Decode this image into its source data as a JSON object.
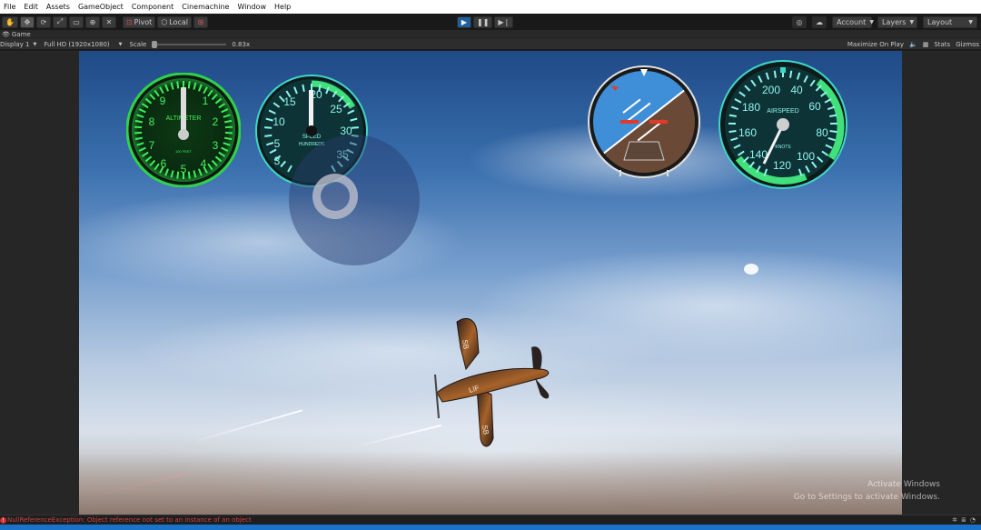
{
  "menu": [
    "File",
    "Edit",
    "Assets",
    "GameObject",
    "Component",
    "Cinemachine",
    "Window",
    "Help"
  ],
  "toolbar": {
    "pivot_label": "Pivot",
    "local_label": "Local",
    "account_label": "Account",
    "layers_label": "Layers",
    "layout_label": "Layout"
  },
  "tab": {
    "title": "Game"
  },
  "gamebar": {
    "display": "Display 1",
    "resolution": "Full HD (1920x1080)",
    "scale_label": "Scale",
    "scale_value": "0.83x",
    "scale_fraction": 0.0,
    "maximize": "Maximize On Play",
    "stats": "Stats",
    "gizmos": "Gizmos"
  },
  "gauges": {
    "altimeter": {
      "label": "ALTIMETER",
      "sub": "100 FEET",
      "numbers": [
        "0",
        "1",
        "2",
        "3",
        "4",
        "5",
        "6",
        "7",
        "8",
        "9"
      ]
    },
    "speed": {
      "label": "SPEED",
      "sub": "HUNDREDS",
      "numbers": [
        "3",
        "5",
        "10",
        "15",
        "20",
        "25",
        "30",
        "35"
      ]
    },
    "airspeed": {
      "label": "AIRSPEED",
      "sub": "KNOTS",
      "numbers": [
        "40",
        "60",
        "80",
        "100",
        "120",
        "140",
        "160",
        "180",
        "200"
      ]
    }
  },
  "plane": {
    "marking_1": "SB",
    "marking_2": "LIF",
    "marking_3": "SB"
  },
  "watermark": {
    "line1": "Activate Windows",
    "line2": "Go to Settings to activate Windows."
  },
  "console": {
    "message": "NullReferenceException: Object reference not set to an instance of an object"
  },
  "colors": {
    "accent": "#1f5f9e",
    "error": "#d03030",
    "gauge_green": "#2fd24a",
    "gauge_teal": "#3ed6c8"
  }
}
